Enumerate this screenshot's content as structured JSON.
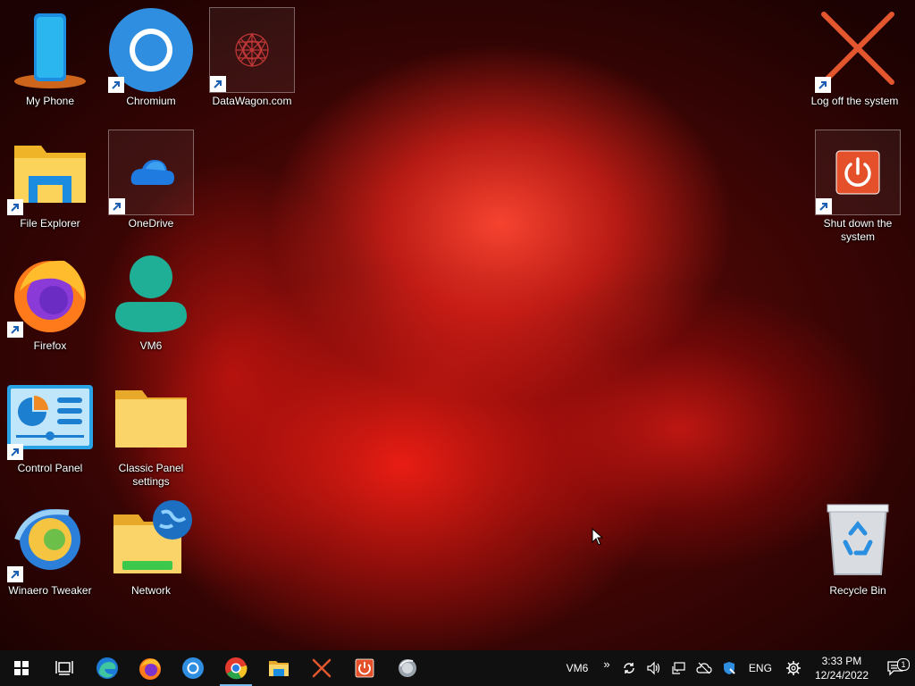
{
  "desktop": {
    "icons": {
      "my_phone": "My Phone",
      "chromium": "Chromium",
      "datawagon": "DataWagon.com",
      "log_off": "Log off the system",
      "file_explorer": "File Explorer",
      "onedrive": "OneDrive",
      "shut_down": "Shut down the system",
      "firefox": "Firefox",
      "vm6": "VM6",
      "control_panel": "Control Panel",
      "classic_panel": "Classic Panel settings",
      "winaero": "Winaero Tweaker",
      "network": "Network",
      "recycle_bin": "Recycle Bin"
    }
  },
  "taskbar": {
    "pinned": [
      "start-icon",
      "task-view-icon",
      "edge-icon",
      "firefox-icon",
      "chromium-icon",
      "chrome-icon",
      "file-explorer-icon",
      "log-off-icon",
      "shut-down-icon",
      "winaero-icon"
    ],
    "active_app": "chrome-icon",
    "tray": {
      "label": "VM6",
      "overflow": "»",
      "language": "ENG",
      "time": "3:33 PM",
      "date": "12/24/2022",
      "notification_count": "1"
    }
  },
  "colors": {
    "taskbar_bg": "#101010",
    "accent": "#76b9ed",
    "folder": "#f8c94a"
  }
}
